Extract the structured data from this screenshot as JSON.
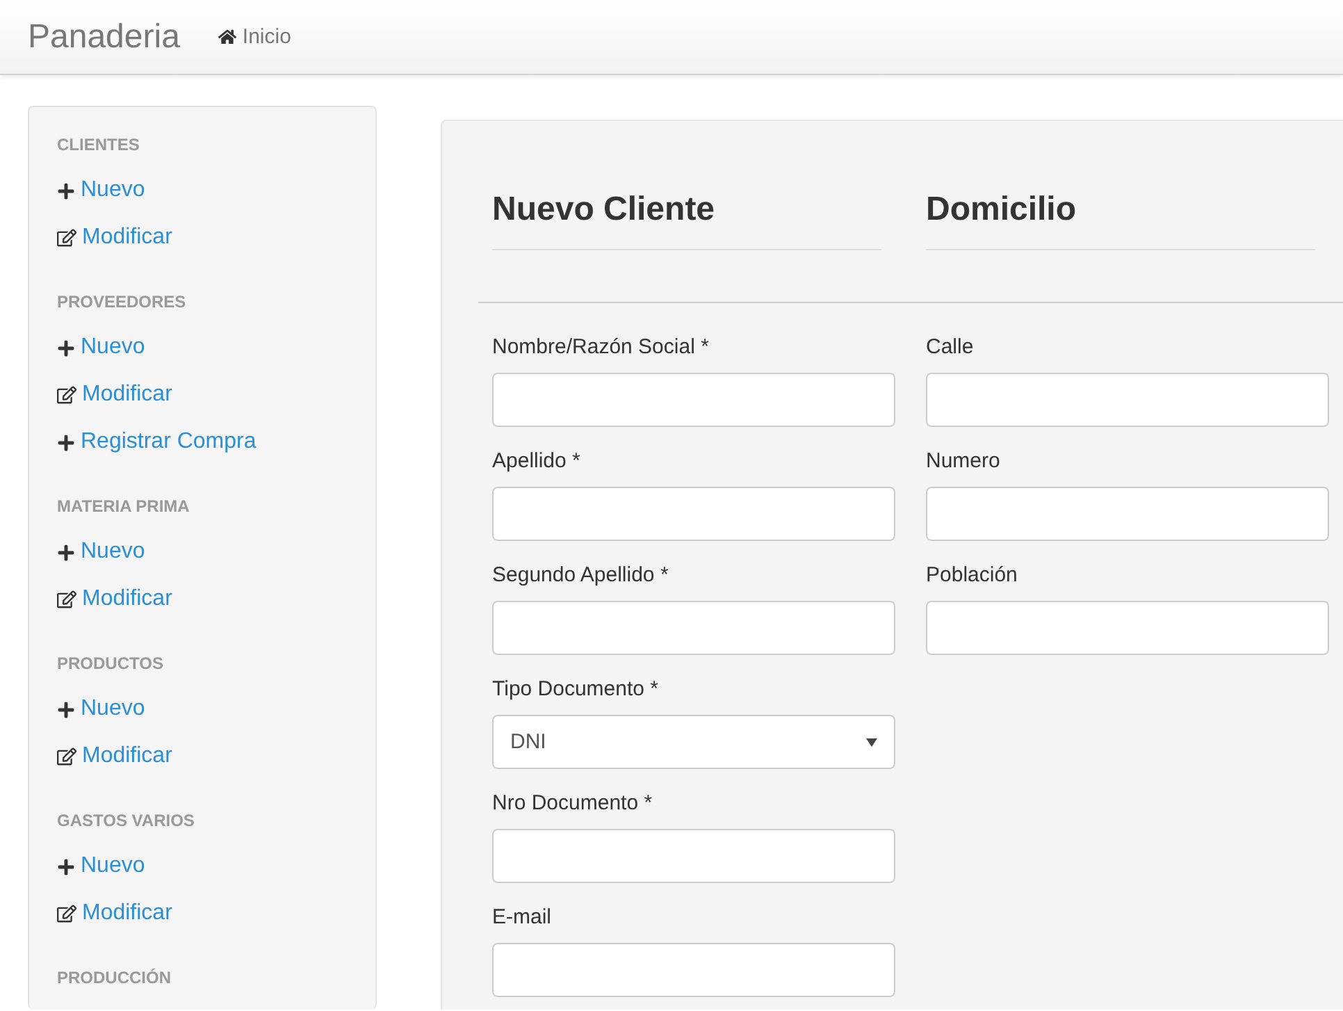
{
  "navbar": {
    "brand": "Panaderia",
    "links": [
      {
        "label": "Inicio"
      }
    ]
  },
  "sidebar": {
    "sections": [
      {
        "title": "CLIENTES",
        "items": [
          {
            "label": "Nuevo",
            "kind": "add"
          },
          {
            "label": "Modificar",
            "kind": "edit"
          }
        ]
      },
      {
        "title": "PROVEEDORES",
        "items": [
          {
            "label": "Nuevo",
            "kind": "add"
          },
          {
            "label": "Modificar",
            "kind": "edit"
          },
          {
            "label": "Registrar Compra",
            "kind": "add"
          }
        ]
      },
      {
        "title": "MATERIA PRIMA",
        "items": [
          {
            "label": "Nuevo",
            "kind": "add"
          },
          {
            "label": "Modificar",
            "kind": "edit"
          }
        ]
      },
      {
        "title": "PRODUCTOS",
        "items": [
          {
            "label": "Nuevo",
            "kind": "add"
          },
          {
            "label": "Modificar",
            "kind": "edit"
          }
        ]
      },
      {
        "title": "GASTOS VARIOS",
        "items": [
          {
            "label": "Nuevo",
            "kind": "add"
          },
          {
            "label": "Modificar",
            "kind": "edit"
          }
        ]
      },
      {
        "title": "PRODUCCIÓN"
      }
    ]
  },
  "form": {
    "columns": [
      {
        "heading": "Nuevo Cliente",
        "fields": [
          {
            "label": "Nombre/Razón Social *",
            "kind": "text"
          },
          {
            "label": "Apellido *",
            "kind": "text"
          },
          {
            "label": "Segundo Apellido *",
            "kind": "text"
          },
          {
            "label": "Tipo Documento *",
            "kind": "select",
            "value": "DNI"
          },
          {
            "label": "Nro Documento *",
            "kind": "text"
          },
          {
            "label": "E-mail",
            "kind": "text"
          }
        ]
      },
      {
        "heading": "Domicilio",
        "fields": [
          {
            "label": "Calle",
            "kind": "text"
          },
          {
            "label": "Numero",
            "kind": "text"
          },
          {
            "label": "Población",
            "kind": "text"
          }
        ]
      }
    ]
  }
}
